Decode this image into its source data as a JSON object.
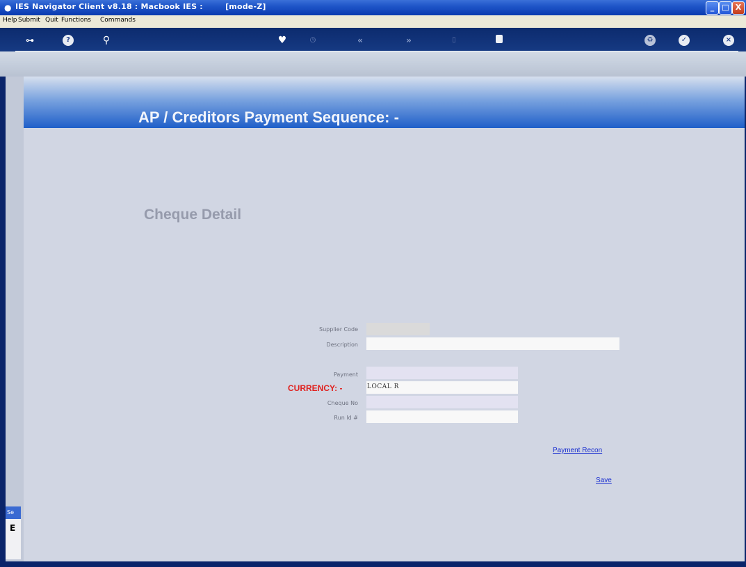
{
  "window": {
    "title": "IES Navigator Client v8.18 : Macbook IES :        [mode-Z]",
    "minimize_glyph": "_",
    "maximize_glyph": "□",
    "close_glyph": "X"
  },
  "menu": {
    "items": [
      "Help",
      "Submit",
      "Quit",
      "Functions",
      "Commands"
    ]
  },
  "toolbar": {
    "icons": [
      "key-icon",
      "help-icon",
      "search-icon",
      "heart-icon",
      "clock-icon",
      "back-icon",
      "forward-icon",
      "document-icon",
      "stop-icon",
      "recycle-icon",
      "check-icon",
      "close-icon"
    ]
  },
  "page": {
    "title": "AP / Creditors Payment Sequence: -",
    "section": "Cheque Detail"
  },
  "form": {
    "supplier_code_label": "Supplier Code",
    "supplier_code_value": "",
    "description_label": "Description",
    "description_value": "",
    "payment_label": "Payment",
    "payment_value": "",
    "currency_label": "CURRENCY: -",
    "currency_value": "LOCAL R",
    "cheque_no_label": "Cheque No",
    "cheque_no_value": "",
    "run_id_label": "Run Id #",
    "run_id_value": ""
  },
  "links": {
    "payment_recon": "Payment Recon",
    "save": "Save"
  },
  "side": {
    "tab_label": "Se",
    "char": "E"
  }
}
